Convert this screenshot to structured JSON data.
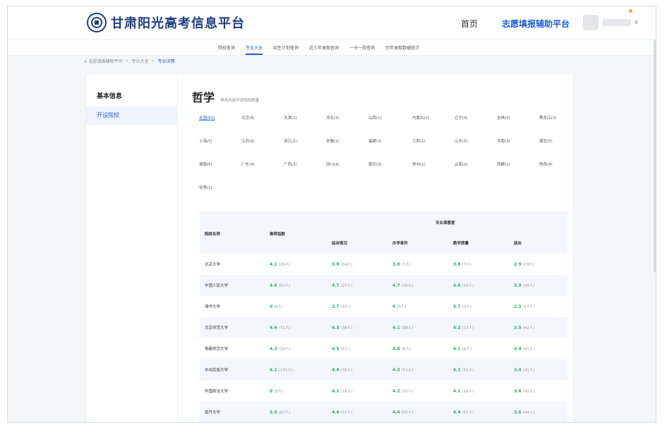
{
  "header": {
    "site_title": "甘肃阳光高考信息平台",
    "nav_home": "首页",
    "nav_assist": "志愿填报辅助平台"
  },
  "subnav": {
    "items": [
      {
        "label": "院校查询",
        "active": false
      },
      {
        "label": "专业大全",
        "active": true
      },
      {
        "label": "招生计划查询",
        "active": false
      },
      {
        "label": "近三年录取查询",
        "active": false
      },
      {
        "label": "一分一段查询",
        "active": false
      },
      {
        "label": "历年录取数据统计",
        "active": false
      }
    ]
  },
  "breadcrumb": {
    "items": [
      "志愿填报辅助平台",
      "专业大全"
    ],
    "current": "专业详情",
    "sep": ">"
  },
  "sidebar": {
    "title": "基本信息",
    "item": "开设院校"
  },
  "major": {
    "name": "哲学",
    "subtitle": "排序内容开设院校数量"
  },
  "provinces": [
    [
      "全国(63)",
      "北京(8)",
      "天津(1)",
      "河北(1)",
      "山西(1)",
      "内蒙古(2)",
      "辽宁(4)",
      "吉林(3)",
      "黑龙江(3)"
    ],
    [
      "上海(5)",
      "江苏(6)",
      "浙江(2)",
      "安徽(1)",
      "福建(2)",
      "江西(1)",
      "山东(5)",
      "河南(3)",
      "湖北(5)"
    ],
    [
      "湖南(5)",
      "广东(4)",
      "广西(3)",
      "四川(4)",
      "重庆(3)",
      "贵州(1)",
      "云南(2)",
      "西藏(1)",
      "陕西(4)"
    ],
    [
      "甘肃(2)"
    ]
  ],
  "table": {
    "headers": {
      "school": "院校名称",
      "recommend": "推荐指数",
      "group": "专业满意度",
      "overall": "综合情况",
      "conditions": "办学条件",
      "quality": "教学质量",
      "employment": "就业"
    },
    "rows": [
      {
        "school": "北京大学",
        "recommend": [
          "4.1",
          "(20人)"
        ],
        "overall": [
          "3.8",
          "(14人)"
        ],
        "conditions": [
          "3.8",
          "(7人)"
        ],
        "quality": [
          "3.8",
          "(7人)"
        ],
        "employment": [
          "2.9",
          "(18人)"
        ]
      },
      {
        "school": "中国人民大学",
        "recommend": [
          "4.6",
          "(52人)"
        ],
        "overall": [
          "4.7",
          "(27人)"
        ],
        "conditions": [
          "4.7",
          "(26人)"
        ],
        "quality": [
          "4.6",
          "(26人)"
        ],
        "employment": [
          "3.9",
          "(48人)"
        ]
      },
      {
        "school": "清华大学",
        "recommend": [
          "0",
          "(0人)"
        ],
        "overall": [
          "3.7",
          "(3人)"
        ],
        "conditions": [
          "4",
          "(4人)"
        ],
        "quality": [
          "3.7",
          "(3人)"
        ],
        "employment": [
          "2.3",
          "(57人)"
        ]
      },
      {
        "school": "北京师范大学",
        "recommend": [
          "4.4",
          "(71人)"
        ],
        "overall": [
          "4.3",
          "(38人)"
        ],
        "conditions": [
          "4.1",
          "(38人)"
        ],
        "quality": [
          "4.2",
          "(37人)"
        ],
        "employment": [
          "3.5",
          "(42人)"
        ]
      },
      {
        "school": "首都师范大学",
        "recommend": [
          "4.3",
          "(29人)"
        ],
        "overall": [
          "4.5",
          "(6人)"
        ],
        "conditions": [
          "4.8",
          "(6人)"
        ],
        "quality": [
          "4.1",
          "(6人)"
        ],
        "employment": [
          "3.4",
          "(41人)"
        ]
      },
      {
        "school": "中央民族大学",
        "recommend": [
          "4.1",
          "(155人)"
        ],
        "overall": [
          "4.4",
          "(55人)"
        ],
        "conditions": [
          "4.3",
          "(51人)"
        ],
        "quality": [
          "4.1",
          "(51人)"
        ],
        "employment": [
          "3.4",
          "(41人)"
        ]
      },
      {
        "school": "中国政法大学",
        "recommend": [
          "0",
          "(0人)"
        ],
        "overall": [
          "4.1",
          "(16人)"
        ],
        "conditions": [
          "4.2",
          "(20人)"
        ],
        "quality": [
          "4.1",
          "(16人)"
        ],
        "employment": [
          "3.6",
          "(41人)"
        ]
      },
      {
        "school": "南开大学",
        "recommend": [
          "3.5",
          "(67人)"
        ],
        "overall": [
          "4.4",
          "(57人)"
        ],
        "conditions": [
          "4.4",
          "(55人)"
        ],
        "quality": [
          "4.4",
          "(57人)"
        ],
        "employment": [
          "3.6",
          "(44人)"
        ]
      }
    ]
  },
  "colors": {
    "brand": "#1f3f82",
    "accent": "#1f5fd0",
    "score": "#2eb05e",
    "row_alt": "#f3f6fb"
  }
}
